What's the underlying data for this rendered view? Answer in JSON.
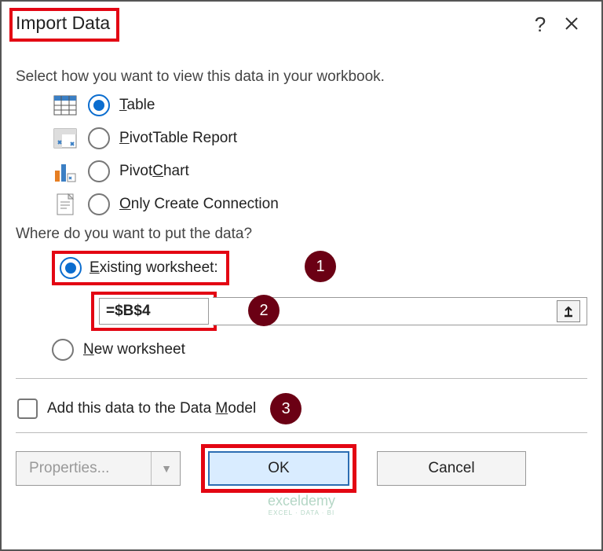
{
  "title": "Import Data",
  "section1_label": "Select how you want to view this data in your workbook.",
  "view_options": {
    "table": "Table",
    "pivot_table": "PivotTable Report",
    "pivot_chart": "PivotChart",
    "only_connection": "Only Create Connection"
  },
  "section2_label": "Where do you want to put the data?",
  "put_options": {
    "existing": "Existing worksheet:",
    "range_value": "=$B$4",
    "new_ws": "New worksheet"
  },
  "checkbox_label": "Add this data to the Data Model",
  "buttons": {
    "properties": "Properties...",
    "ok": "OK",
    "cancel": "Cancel"
  },
  "steps": {
    "s1": "1",
    "s2": "2",
    "s3": "3"
  },
  "watermark": {
    "main": "exceldemy",
    "sub": "EXCEL · DATA · BI"
  }
}
